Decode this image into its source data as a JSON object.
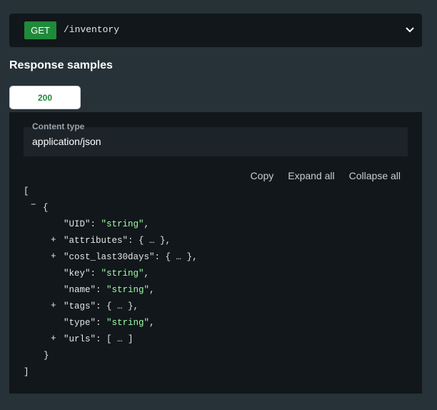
{
  "endpoint": {
    "method": "GET",
    "path": "/inventory"
  },
  "heading": "Response samples",
  "tabs": [
    {
      "label": "200"
    }
  ],
  "content_type": {
    "label": "Content type",
    "value": "application/json"
  },
  "actions": {
    "copy": "Copy",
    "expand_all": "Expand all",
    "collapse_all": "Collapse all"
  },
  "code": {
    "open_bracket": "[",
    "collapse_toggle": "−",
    "open_brace": "{",
    "expand_toggle": "+",
    "fields": {
      "uid_key": "\"UID\"",
      "uid_val": "\"string\"",
      "attributes_key": "\"attributes\"",
      "attributes_val": "{ … }",
      "cost_key": "\"cost_last30days\"",
      "cost_val": "{ … }",
      "key_key": "\"key\"",
      "key_val": "\"string\"",
      "name_key": "\"name\"",
      "name_val": "\"string\"",
      "tags_key": "\"tags\"",
      "tags_val": "{ … }",
      "type_key": "\"type\"",
      "type_val": "\"string\"",
      "urls_key": "\"urls\"",
      "urls_val": "[ … ]"
    },
    "close_brace": "}",
    "close_bracket": "]"
  },
  "colors": {
    "page_bg": "#263238",
    "panel_bg": "#11171a",
    "method_bg": "#1f8a3a",
    "string": "#a0fbaa"
  },
  "icons": {
    "expand": "chevron-down-icon"
  }
}
